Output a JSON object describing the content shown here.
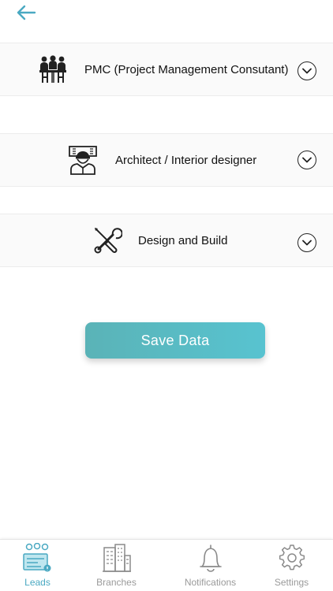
{
  "header": {
    "back_icon": "arrow-left-icon",
    "accent_color": "#4aa9c2"
  },
  "categories": [
    {
      "label": "PMC (Project Management Consutant)",
      "icon": "meeting-people-icon"
    },
    {
      "label": "Architect / Interior designer",
      "icon": "architect-worker-icon"
    },
    {
      "label": "Design and Build",
      "icon": "wrench-screwdriver-icon"
    }
  ],
  "save_button": {
    "label": "Save Data",
    "gradient": [
      "#5ab3b7",
      "#58c3d0"
    ]
  },
  "tabbar": {
    "active": "Leads",
    "items": [
      {
        "label": "Leads",
        "icon": "leads-icon"
      },
      {
        "label": "Branches",
        "icon": "buildings-icon"
      },
      {
        "label": "Notifications",
        "icon": "bell-icon"
      },
      {
        "label": "Settings",
        "icon": "gear-icon"
      }
    ]
  }
}
